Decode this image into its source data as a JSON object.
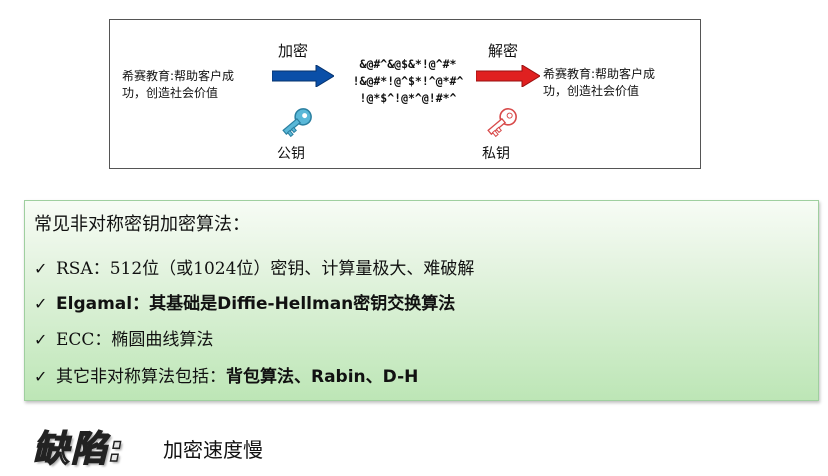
{
  "diagram": {
    "plaintext_left": [
      "希赛教育:帮助客户成",
      "功，创造社会价值"
    ],
    "plaintext_right": [
      "希赛教育:帮助客户成",
      "功，创造社会价值"
    ],
    "encrypt_label": "加密",
    "decrypt_label": "解密",
    "ciphertext": [
      "&@#^&@$&*!@^#*",
      "!&@#*!@^$*!^@*#^",
      "!@*$^!@*^@!#*^"
    ],
    "public_key_label": "公钥",
    "private_key_label": "私钥",
    "colors": {
      "encrypt_arrow": "#0a4fa8",
      "decrypt_arrow": "#e02020",
      "public_key": "#5ab8d8",
      "private_key": "#e87f7f"
    },
    "icons": [
      "arrow-right-icon",
      "key-icon"
    ]
  },
  "algorithms": {
    "title": "常见非对称密钥加密算法：",
    "bullet_icon": "check-icon",
    "items": [
      {
        "text": "RSA：512位（或1024位）密钥、计算量极大、难破解"
      },
      {
        "text": "Elgamal：其基础是Diffie-Hellman密钥交换算法"
      },
      {
        "text": "ECC：椭圆曲线算法"
      },
      {
        "prefix": "其它非对称算法包括：",
        "strong": "背包算法、Rabin、D-H"
      }
    ]
  },
  "drawback": {
    "label": "缺陷:",
    "text": "加密速度慢"
  }
}
